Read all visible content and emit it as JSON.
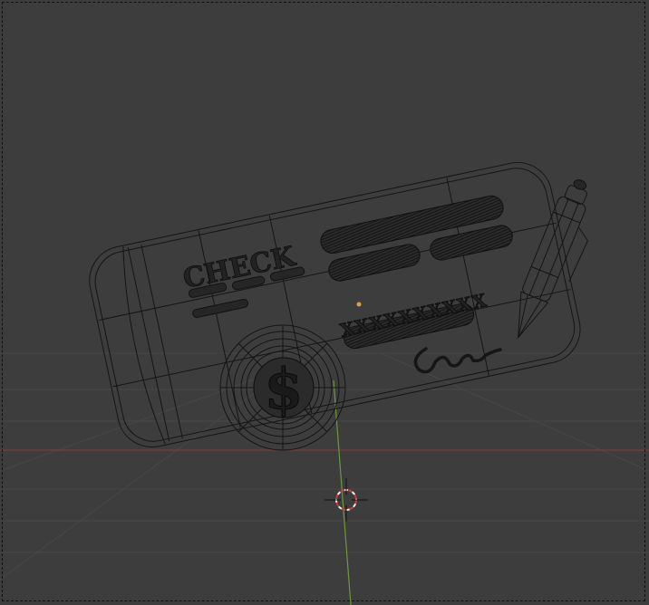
{
  "model": {
    "check_label": "CHECK",
    "dollar_symbol": "$",
    "amount_marks": "XXXXXXXXXX"
  },
  "colors": {
    "background": "#3d3d3d",
    "wireframe": "#151515",
    "x_axis": "#8a3c3c",
    "y_axis": "#6a9a3a",
    "grid": "#4a4a4a",
    "cursor_red": "#d33a3a",
    "origin_dot": "#e0a040"
  },
  "icons": {
    "cursor": "3d-cursor-icon",
    "origin": "object-origin-icon"
  }
}
